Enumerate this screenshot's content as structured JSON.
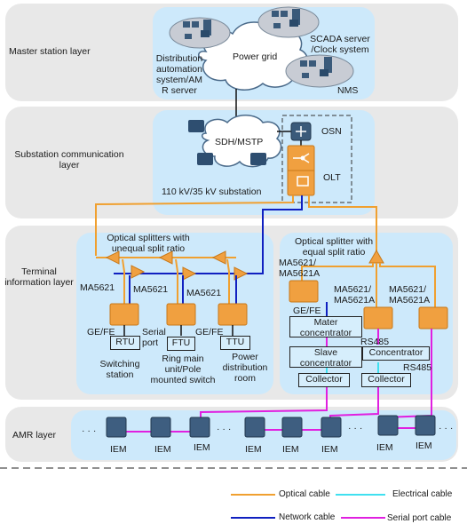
{
  "layers": {
    "master": "Master station layer",
    "substation": "Substation communication layer",
    "terminal": "Terminal information layer",
    "amr": "AMR layer"
  },
  "master": {
    "cloud": "Power grid",
    "distribution": "Distribution automation system/AM R server",
    "scada": "SCADA server /Clock system",
    "nms": "NMS"
  },
  "substation": {
    "cloud": "SDH/MSTP",
    "osn": "OSN",
    "olt": "OLT",
    "site": "110 kV/35 kV substation"
  },
  "terminal": {
    "unequal_title": "Optical splitters with unequal split ratio",
    "equal_title": "Optical splitter with equal split ratio",
    "left_onus": [
      {
        "model": "MA5621",
        "port": "GE/FE",
        "device": "RTU",
        "site": "Switching station"
      },
      {
        "model": "MA5621",
        "port": "Serial port",
        "device": "FTU",
        "site": "Ring main unit/Pole mounted switch"
      },
      {
        "model": "MA5621",
        "port": "GE/FE",
        "device": "TTU",
        "site": "Power distribution room"
      }
    ],
    "right_onus": [
      {
        "model": "MA5621/ MA5621A"
      },
      {
        "model": "MA5621/ MA5621A"
      },
      {
        "model": "MA5621/ MA5621A"
      }
    ],
    "right_port_gefe": "GE/FE",
    "master_concentrator": "Mater concentrator",
    "slave_concentrator": "Slave concentrator",
    "concentrator": "Concentrator",
    "collector": "Collector",
    "rs485_a": "RS485",
    "rs485_b": "RS485"
  },
  "amr": {
    "meters": [
      "IEM",
      "IEM",
      "IEM",
      "IEM",
      "IEM",
      "IEM",
      "IEM",
      "IEM"
    ],
    "ellipsis": "· · ·"
  },
  "legend": {
    "items": [
      {
        "label": "Optical cable",
        "color": "#f0a030"
      },
      {
        "label": "Electrical cable",
        "color": "#40e0f0"
      },
      {
        "label": "Network cable",
        "color": "#1020c0"
      },
      {
        "label": "Serial port cable",
        "color": "#e020e0"
      }
    ]
  },
  "colors": {
    "optical": "#f0a030",
    "network": "#1020c0",
    "electrical": "#40e0f0",
    "serial": "#e020e0",
    "device_orange": "#f0a040",
    "device_blue": "#3a5a7a"
  }
}
